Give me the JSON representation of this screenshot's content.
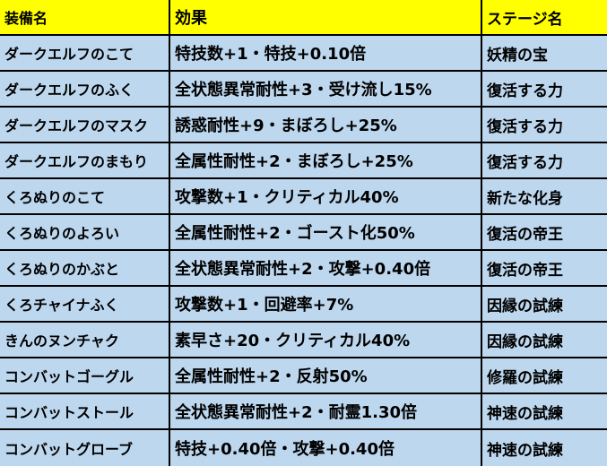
{
  "header": {
    "col1": "装備名",
    "col2": "効果",
    "col3": "ステージ名"
  },
  "colors": {
    "header_bg": "#ffff00",
    "row_bg": "#bdd7ee",
    "border": "#000000"
  },
  "rows": [
    {
      "name": "ダークエルフのこて",
      "effect": "特技数+1・特技+0.10倍",
      "stage": "妖精の宝"
    },
    {
      "name": "ダークエルフのふく",
      "effect": "全状態異常耐性+3・受け流し15%",
      "stage": "復活する力"
    },
    {
      "name": "ダークエルフのマスク",
      "effect": "誘惑耐性+9・まぼろし+25%",
      "stage": "復活する力"
    },
    {
      "name": "ダークエルフのまもり",
      "effect": "全属性耐性+2・まぼろし+25%",
      "stage": "復活する力"
    },
    {
      "name": "くろぬりのこて",
      "effect": "攻撃数+1・クリティカル40%",
      "stage": "新たな化身"
    },
    {
      "name": "くろぬりのよろい",
      "effect": "全属性耐性+2・ゴースト化50%",
      "stage": "復活の帝王"
    },
    {
      "name": "くろぬりのかぶと",
      "effect": "全状態異常耐性+2・攻撃+0.40倍",
      "stage": "復活の帝王"
    },
    {
      "name": "くろチャイナふく",
      "effect": "攻撃数+1・回避率+7%",
      "stage": "因縁の試練"
    },
    {
      "name": "きんのヌンチャク",
      "effect": "素早さ+20・クリティカル40%",
      "stage": "因縁の試練"
    },
    {
      "name": "コンバットゴーグル",
      "effect": "全属性耐性+2・反射50%",
      "stage": "修羅の試練"
    },
    {
      "name": "コンバットストール",
      "effect": "全状態異常耐性+2・耐霊1.30倍",
      "stage": "神速の試練"
    },
    {
      "name": "コンバットグローブ",
      "effect": "特技+0.40倍・攻撃+0.40倍",
      "stage": "神速の試練"
    }
  ]
}
